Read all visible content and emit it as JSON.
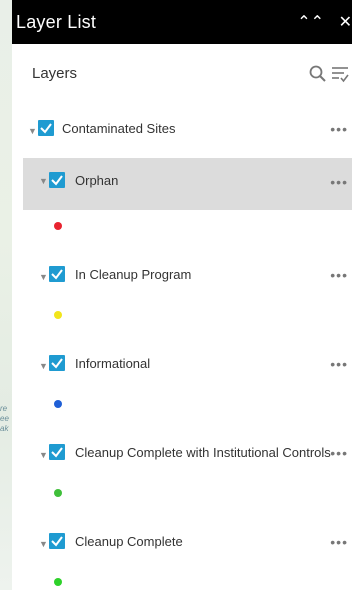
{
  "panel": {
    "title": "Layer List"
  },
  "layers_section": {
    "label": "Layers"
  },
  "layers": [
    {
      "label": "Contaminated Sites",
      "checked": true,
      "expanded": true
    },
    {
      "label": "Orphan",
      "checked": true,
      "expanded": true,
      "selected": true,
      "symbol_color": "#e8232f"
    },
    {
      "label": "In Cleanup Program",
      "checked": true,
      "expanded": true,
      "symbol_color": "#f2e51b"
    },
    {
      "label": "Informational",
      "checked": true,
      "expanded": true,
      "symbol_color": "#1f5fd6"
    },
    {
      "label": "Cleanup Complete with Institutional Controls",
      "checked": true,
      "expanded": true,
      "symbol_color": "#3fbf3a"
    },
    {
      "label": "Cleanup Complete",
      "checked": true,
      "expanded": true,
      "symbol_color": "#2ed12a"
    }
  ],
  "colors": {
    "accent": "#1f9bd1",
    "titlebar": "#000000",
    "selected_row": "#dcdcdc"
  },
  "icons": [
    "collapse-icon",
    "close-icon",
    "search-icon",
    "filter-icon",
    "caret-down-icon",
    "checkbox-checked-icon",
    "more-options-icon"
  ]
}
